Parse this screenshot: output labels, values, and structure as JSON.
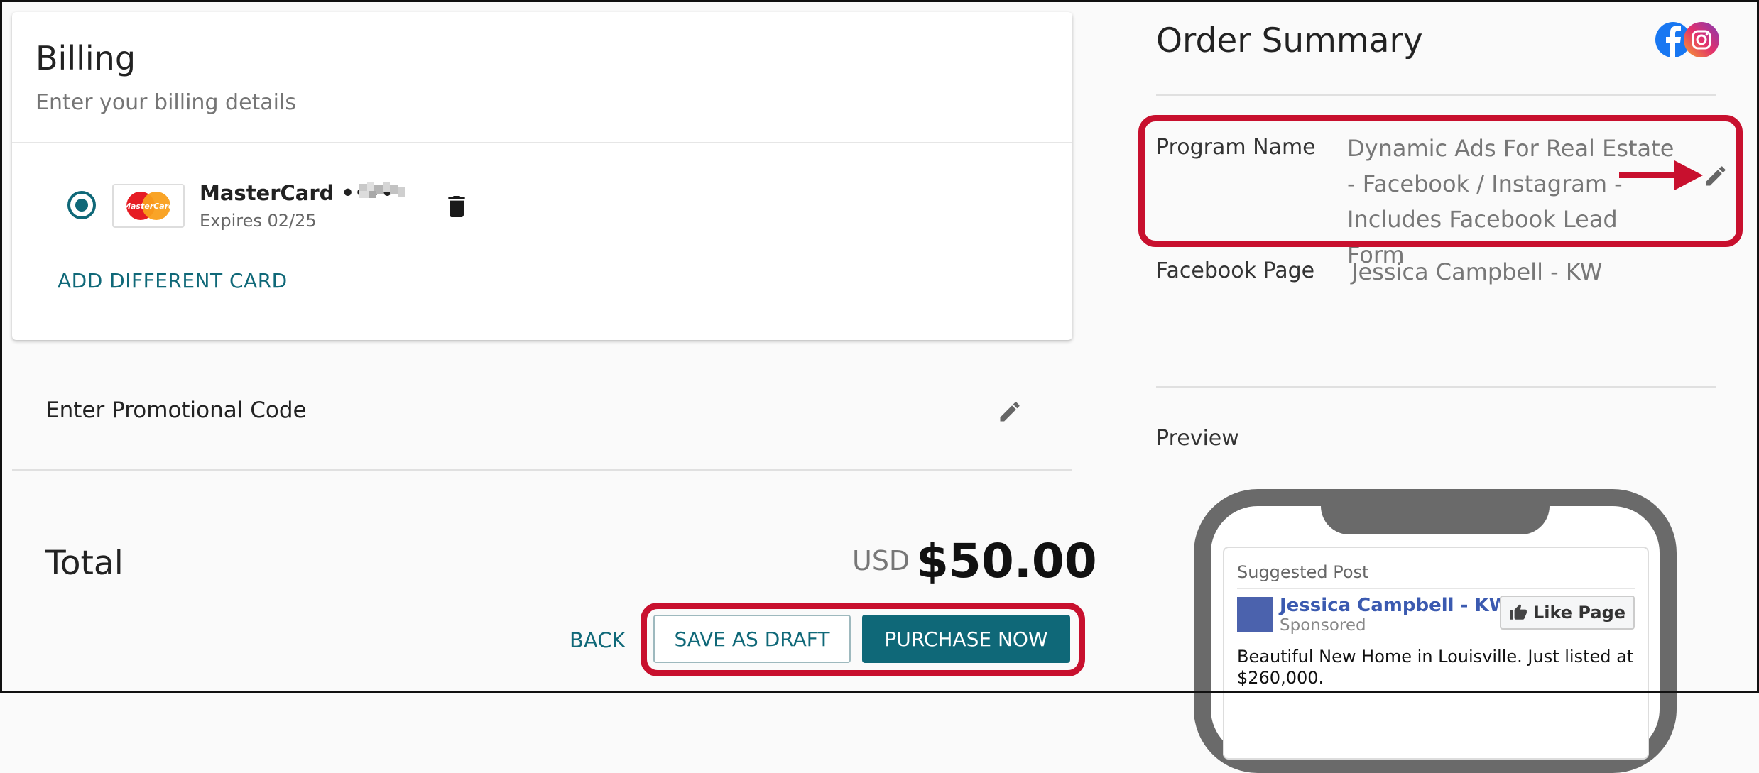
{
  "billing": {
    "title": "Billing",
    "subtitle": "Enter your billing details",
    "card": {
      "name": "MasterCard ••••",
      "expires": "Expires 02/25",
      "logo_text": "MasterCard"
    },
    "add_card_label": "ADD DIFFERENT CARD"
  },
  "promo": {
    "label": "Enter Promotional Code"
  },
  "total": {
    "label": "Total",
    "currency": "USD",
    "amount": "$50.00"
  },
  "actions": {
    "back_label": "BACK",
    "draft_label": "SAVE AS DRAFT",
    "purchase_label": "PURCHASE NOW"
  },
  "order_summary": {
    "title": "Order Summary",
    "program_label": "Program Name",
    "program_value": "Dynamic Ads For Real Estate - Facebook / Instagram - Includes Facebook Lead Form",
    "page_label": "Facebook Page",
    "page_value": "Jessica Campbell - KW",
    "preview_label": "Preview"
  },
  "preview_post": {
    "suggested": "Suggested Post",
    "page_name": "Jessica Campbell - KW",
    "sponsored": "Sponsored",
    "like_label": "Like Page",
    "text": "Beautiful New Home in Louisville. Just listed at $260,000."
  },
  "colors": {
    "accent": "#0f6878",
    "highlight": "#c8102e",
    "facebook_blue": "#1877f2"
  }
}
